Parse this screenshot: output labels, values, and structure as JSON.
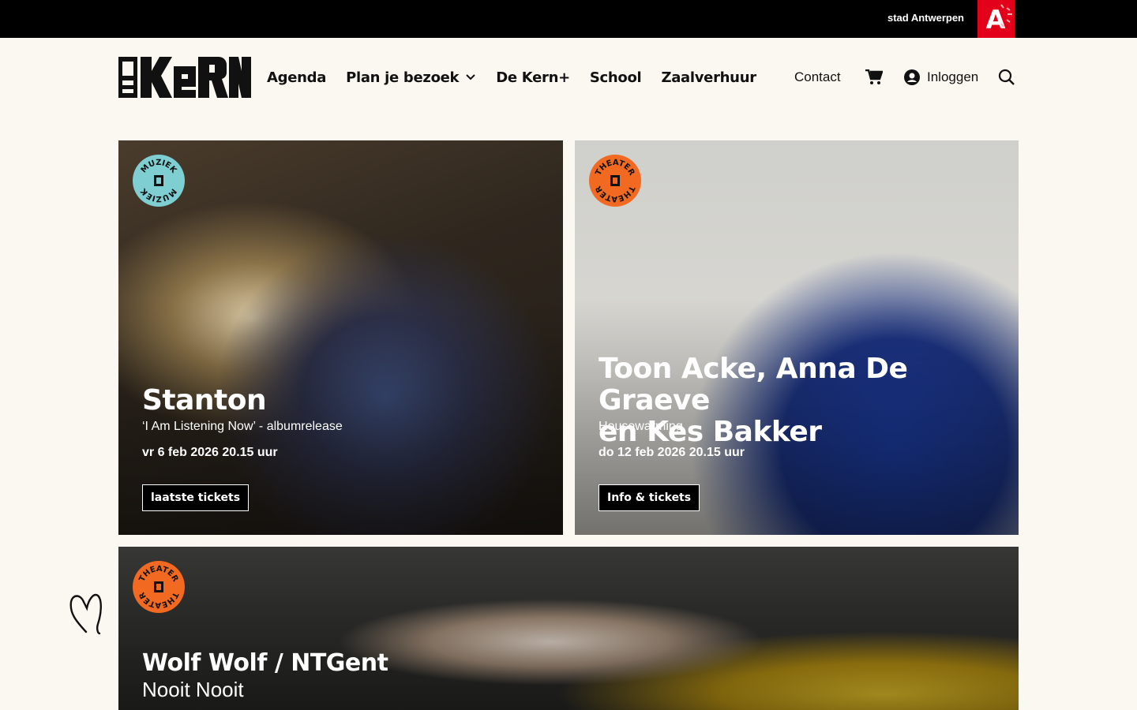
{
  "topbar": {
    "city_label": "stad Antwerpen",
    "logo_letter": "A"
  },
  "header": {
    "logo_alt": "De Kern",
    "nav": [
      {
        "label": "Agenda"
      },
      {
        "label": "Plan je bezoek",
        "has_dropdown": true
      },
      {
        "label": "De Kern+"
      },
      {
        "label": "School"
      },
      {
        "label": "Zaalverhuur"
      }
    ],
    "contact": "Contact",
    "login": "Inloggen"
  },
  "cards": [
    {
      "category": "MUZIEK",
      "badge_color": "#7fcfd2",
      "title": "Stanton",
      "subtitle": "‘I Am Listening Now’ - albumrelease",
      "date": "vr 6 feb 2026 20.15 uur",
      "button": "laatste tickets"
    },
    {
      "category": "THEATER",
      "badge_color": "#f26a21",
      "title_line1": "Toon Acke, Anna De Graeve",
      "title_line2": "en Kes Bakker",
      "subtitle": "Housewarming",
      "date": "do 12 feb 2026 20.15 uur",
      "button": "Info & tickets"
    },
    {
      "category": "THEATER",
      "badge_color": "#f26a21",
      "title": "Wolf Wolf / NTGent",
      "subtitle": "Nooit Nooit"
    }
  ],
  "colors": {
    "background": "#fbf8f1",
    "city_red": "#e3001b"
  }
}
